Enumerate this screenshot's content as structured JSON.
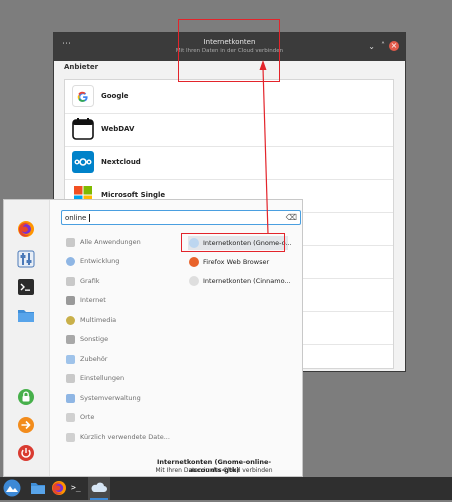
{
  "window": {
    "title": "Internetkonten",
    "subtitle": "Mit Ihren Daten in der Cloud verbinden",
    "menu_dots": "⋯",
    "minimize": "⌄",
    "maximize": "˄",
    "close": "×",
    "section_label": "Anbieter",
    "providers": [
      {
        "label": "Google",
        "icon": "google-icon"
      },
      {
        "label": "WebDAV",
        "icon": "calendar-icon"
      },
      {
        "label": "Nextcloud",
        "icon": "nextcloud-icon"
      },
      {
        "label": "Microsoft Single",
        "icon": "microsoft-icon"
      }
    ]
  },
  "menu": {
    "search_value": "online",
    "clear_icon": "⌫",
    "categories": [
      {
        "label": "Alle Anwendungen",
        "color": "#c9c9c9"
      },
      {
        "label": "Entwicklung",
        "color": "#8fb6e4"
      },
      {
        "label": "Grafik",
        "color": "#c9c9c9"
      },
      {
        "label": "Internet",
        "color": "#9a9a9a"
      },
      {
        "label": "Multimedia",
        "color": "#c9b04a"
      },
      {
        "label": "Sonstige",
        "color": "#a8a8a8"
      },
      {
        "label": "Zubehör",
        "color": "#9fc3ea"
      },
      {
        "label": "Einstellungen",
        "color": "#c9c9c9"
      },
      {
        "label": "Systemverwaltung",
        "color": "#8fb6e4"
      },
      {
        "label": "Orte",
        "color": "#d0d0d0"
      },
      {
        "label": "Kürzlich verwendete Date...",
        "color": "#d0d0d0"
      }
    ],
    "results": [
      {
        "label": "Internetkonten (Gnome-o...",
        "color": "#bcd6f0"
      },
      {
        "label": "Firefox Web Browser",
        "color": "#e8622a"
      },
      {
        "label": "Internetkonten (Cinnamo...",
        "color": "#dedede"
      }
    ],
    "description_title": "Internetkonten (Gnome-online-accounts-gtk)",
    "description_text": "Mit Ihren Daten in der Cloud verbinden"
  },
  "taskbar": {
    "terminal_prompt": ">_"
  },
  "colors": {
    "annotation": "#e3242b",
    "accent": "#4a9fe0",
    "titlebar": "#3b3b3b"
  }
}
